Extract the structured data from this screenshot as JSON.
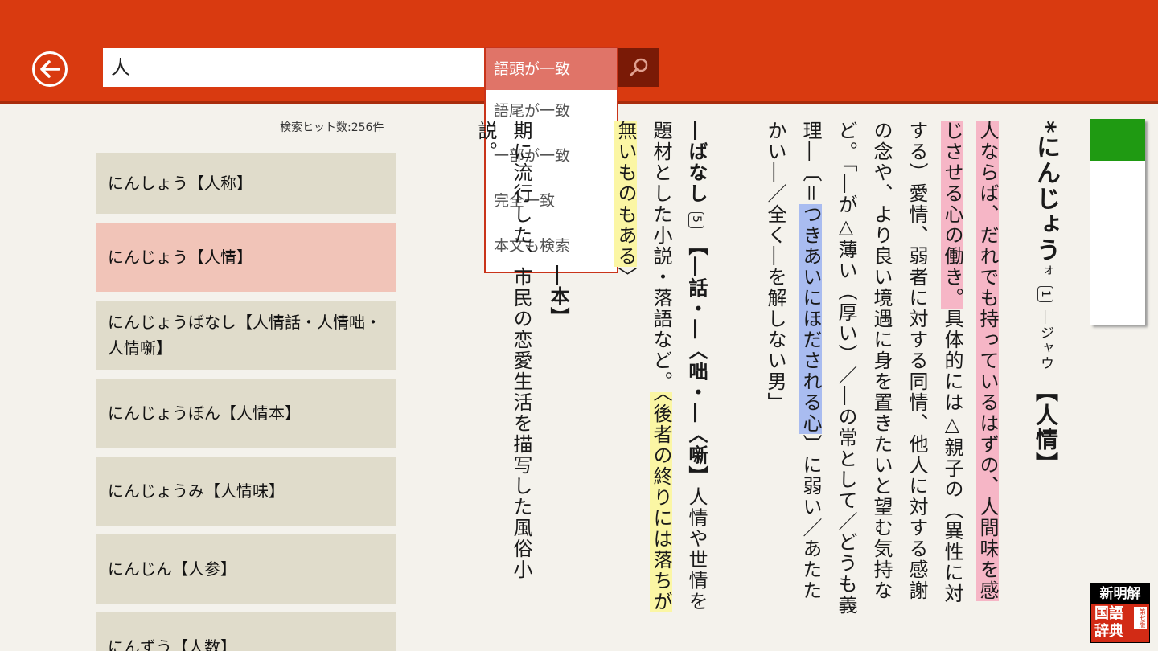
{
  "search": {
    "query": "人",
    "options": [
      "語頭が一致",
      "語尾が一致",
      "一部が一致",
      "完全一致",
      "本文も検索"
    ]
  },
  "results": {
    "hit_count": "検索ヒット数:256件",
    "items": [
      {
        "label": "にんしょう【人称】"
      },
      {
        "label": "にんじょう【人情】"
      },
      {
        "label": "にんじょうばなし【人情話・人情咄・人情噺】"
      },
      {
        "label": "にんじょうぼん【人情本】"
      },
      {
        "label": "にんじょうみ【人情味】"
      },
      {
        "label": "にんじん【人参】"
      },
      {
        "label": "にんずう【人数】"
      }
    ]
  },
  "entry": {
    "headword": "にんじょう",
    "mark": "*",
    "accent": "ォ",
    "sense_num": "1",
    "reading_note": "―ジャウ",
    "kanji": "【人情】",
    "def1": "人ならば、だれでも持っているはずの、人間味を感じさせる心の働き。",
    "def2": "具体的には△親子の（異性に対する）愛情、弱者に対する同情、他人に対する感謝の念や、より良い境遇に身を置きたいと望む気持など。",
    "ex1": "「―が△薄い（厚い）／―の常として／どうも義理―〔＝",
    "ex1_hl": "つきあいにほだされる心",
    "ex1_end": "〕に弱い／あたたかい―／全く―を解しない男」",
    "sub_head": "―ばなし",
    "sub_num": "5",
    "sub_kanji": "【―話・―〈咄・―〈噺】",
    "sub_def": "人情や世情を題材とした小説・落語など。",
    "sub_hl_start": "〈後",
    "sub_hl": "者の終りには落ちが無いものもある",
    "sub_hl_end": "〉",
    "hon": "―本】",
    "hon_def": "期に流行した、市民の恋愛生活を描写した風俗小説。"
  },
  "progress": {
    "fraction": 0.2
  },
  "logo": {
    "top": "新明解",
    "main": "国語辞典",
    "edition": "第七版"
  },
  "colors": {
    "accent": "#d93a10",
    "selected": "#f1c4b8",
    "slider": "#1f9a12"
  }
}
